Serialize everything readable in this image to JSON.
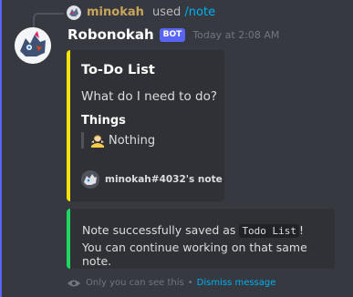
{
  "reply": {
    "username": "minokah",
    "verb": "used",
    "command": "/note"
  },
  "message": {
    "author": "Robonokah",
    "bot_tag": "BOT",
    "timestamp": "Today at 2:08 AM"
  },
  "embed_todo": {
    "accent_color": "#f6e20d",
    "title": "To-Do List",
    "description": "What do I need to do?",
    "field_name": "Things",
    "field_value": "Nothing",
    "footer": "minokah#4032's note"
  },
  "embed_saved": {
    "accent_color": "#1ed760",
    "line1_prefix": "Note successfully saved as",
    "line1_code": "Todo List",
    "line1_suffix": "!",
    "line2": "You can continue working on that same note."
  },
  "ephemeral": {
    "note": "Only you can see this",
    "separator": "•",
    "dismiss_label": "Dismiss message"
  },
  "colors": {
    "background": "#36393f",
    "embed_bg": "#2f3136",
    "link": "#00b0f4",
    "bot_tag": "#5865f2"
  }
}
